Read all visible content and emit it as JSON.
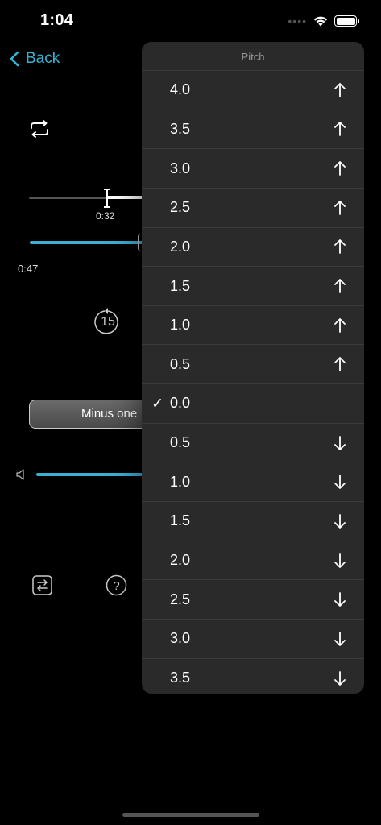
{
  "status_bar": {
    "time": "1:04"
  },
  "nav": {
    "back_label": "Back"
  },
  "player": {
    "scrub_time": "0:32",
    "elapsed_time": "0:47",
    "skip_seconds": "15",
    "minus_one_label": "Minus one"
  },
  "menu": {
    "title": "Pitch",
    "items": [
      {
        "label": "4.0",
        "direction": "up",
        "selected": false
      },
      {
        "label": "3.5",
        "direction": "up",
        "selected": false
      },
      {
        "label": "3.0",
        "direction": "up",
        "selected": false
      },
      {
        "label": "2.5",
        "direction": "up",
        "selected": false
      },
      {
        "label": "2.0",
        "direction": "up",
        "selected": false
      },
      {
        "label": "1.5",
        "direction": "up",
        "selected": false
      },
      {
        "label": "1.0",
        "direction": "up",
        "selected": false
      },
      {
        "label": "0.5",
        "direction": "up",
        "selected": false
      },
      {
        "label": "0.0",
        "direction": "none",
        "selected": true
      },
      {
        "label": "0.5",
        "direction": "down",
        "selected": false
      },
      {
        "label": "1.0",
        "direction": "down",
        "selected": false
      },
      {
        "label": "1.5",
        "direction": "down",
        "selected": false
      },
      {
        "label": "2.0",
        "direction": "down",
        "selected": false
      },
      {
        "label": "2.5",
        "direction": "down",
        "selected": false
      },
      {
        "label": "3.0",
        "direction": "down",
        "selected": false
      },
      {
        "label": "3.5",
        "direction": "down",
        "selected": false
      }
    ]
  },
  "colors": {
    "accent": "#35b3d6",
    "menu_bg": "#2a2a2b"
  }
}
